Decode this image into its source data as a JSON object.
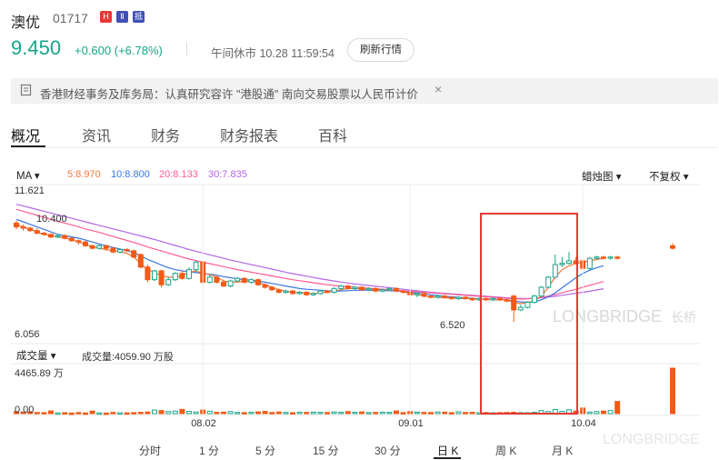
{
  "header": {
    "name": "澳优",
    "code": "01717",
    "badges": [
      {
        "text": "H",
        "color": "#e53935"
      },
      {
        "text": "Ⅱ",
        "color": "#3f51b5"
      },
      {
        "text": "抵",
        "color": "#3f51b5"
      }
    ],
    "price": "9.450",
    "change": "+0.600",
    "change_pct": "(+6.78%)",
    "status": "午间休市 10.28 11:59:54",
    "refresh_label": "刷新行情"
  },
  "notice": {
    "text": "香港财经事务及库务局：认真研究容许 \"港股通\" 南向交易股票以人民币计价",
    "close": "×"
  },
  "tabs": [
    "概况",
    "资讯",
    "财务",
    "财务报表",
    "百科"
  ],
  "indicators": {
    "ma_label": "MA",
    "ma5": "5:8.970",
    "ma10": "10:8.800",
    "ma20": "20:8.133",
    "ma30": "30:7.835",
    "chart_type": "蜡烛图",
    "adjust": "不复权",
    "vol_label": "成交量",
    "vol_value": "成交量:4059.90 万股"
  },
  "colors": {
    "up": "#17a589",
    "down": "#f25a16",
    "ma5": "#f07a3e",
    "ma10": "#3a78e0",
    "ma20": "#ff5c93",
    "ma30": "#b266e8",
    "highlight": "#e53935"
  },
  "watermark": {
    "main": "LONGBRIDGE",
    "cn": "长桥",
    "bottom": "LONGBRIDGE"
  },
  "periods": [
    "分时",
    "1 分",
    "5 分",
    "15 分",
    "30 分",
    "日 K",
    "周 K",
    "月 K"
  ],
  "active_period": "日 K",
  "chart_data": {
    "type": "candlestick",
    "price_axis": {
      "max_label": "11.621",
      "min_label": "6.056",
      "ylim": [
        6.056,
        11.621
      ]
    },
    "annotations": {
      "high": "10.400",
      "low": "6.520"
    },
    "volume_axis": {
      "max_label": "4465.89 万",
      "zero_label": "0.00",
      "ylim": [
        0,
        4465.89
      ]
    },
    "x_ticks": [
      {
        "label": "08.02",
        "index": 27
      },
      {
        "label": "09.01",
        "index": 57
      },
      {
        "label": "10.04",
        "index": 82
      }
    ],
    "candles": [
      {
        "o": 10.45,
        "c": 10.3,
        "h": 10.55,
        "l": 10.2
      },
      {
        "o": 10.3,
        "c": 10.25,
        "h": 10.4,
        "l": 10.15
      },
      {
        "o": 10.25,
        "c": 10.15,
        "h": 10.3,
        "l": 10.1
      },
      {
        "o": 10.15,
        "c": 10.05,
        "h": 10.25,
        "l": 10.0
      },
      {
        "o": 10.05,
        "c": 10.0,
        "h": 10.1,
        "l": 9.95
      },
      {
        "o": 10.0,
        "c": 9.9,
        "h": 10.05,
        "l": 9.85
      },
      {
        "o": 9.9,
        "c": 9.95,
        "h": 10.0,
        "l": 9.85
      },
      {
        "o": 9.95,
        "c": 9.85,
        "h": 10.0,
        "l": 9.8
      },
      {
        "o": 9.85,
        "c": 9.75,
        "h": 9.9,
        "l": 9.7
      },
      {
        "o": 9.75,
        "c": 9.7,
        "h": 9.8,
        "l": 9.6
      },
      {
        "o": 9.7,
        "c": 9.55,
        "h": 9.75,
        "l": 9.5
      },
      {
        "o": 9.55,
        "c": 9.45,
        "h": 9.6,
        "l": 9.4
      },
      {
        "o": 9.45,
        "c": 9.55,
        "h": 9.6,
        "l": 9.4
      },
      {
        "o": 9.55,
        "c": 9.45,
        "h": 9.6,
        "l": 9.35
      },
      {
        "o": 9.45,
        "c": 9.3,
        "h": 9.5,
        "l": 9.25
      },
      {
        "o": 9.3,
        "c": 9.4,
        "h": 9.45,
        "l": 9.25
      },
      {
        "o": 9.4,
        "c": 9.35,
        "h": 9.45,
        "l": 9.3
      },
      {
        "o": 9.35,
        "c": 9.1,
        "h": 9.4,
        "l": 9.05
      },
      {
        "o": 9.2,
        "c": 8.7,
        "h": 9.25,
        "l": 8.65
      },
      {
        "o": 8.7,
        "c": 8.2,
        "h": 8.8,
        "l": 8.1
      },
      {
        "o": 8.2,
        "c": 8.55,
        "h": 8.6,
        "l": 8.15
      },
      {
        "o": 8.55,
        "c": 8.0,
        "h": 8.6,
        "l": 7.9
      },
      {
        "o": 8.0,
        "c": 8.2,
        "h": 8.3,
        "l": 7.95
      },
      {
        "o": 8.2,
        "c": 8.45,
        "h": 8.5,
        "l": 8.15
      },
      {
        "o": 8.45,
        "c": 8.25,
        "h": 8.55,
        "l": 8.2
      },
      {
        "o": 8.25,
        "c": 8.6,
        "h": 8.7,
        "l": 8.2
      },
      {
        "o": 8.6,
        "c": 8.9,
        "h": 8.95,
        "l": 8.5
      },
      {
        "o": 8.9,
        "c": 8.1,
        "h": 8.95,
        "l": 8.0
      },
      {
        "o": 8.1,
        "c": 8.3,
        "h": 8.4,
        "l": 8.05
      },
      {
        "o": 8.3,
        "c": 8.1,
        "h": 8.35,
        "l": 8.05
      },
      {
        "o": 8.1,
        "c": 7.95,
        "h": 8.2,
        "l": 7.9
      },
      {
        "o": 7.95,
        "c": 8.15,
        "h": 8.2,
        "l": 7.9
      },
      {
        "o": 8.15,
        "c": 8.25,
        "h": 8.3,
        "l": 8.1
      },
      {
        "o": 8.25,
        "c": 8.1,
        "h": 8.3,
        "l": 8.05
      },
      {
        "o": 8.1,
        "c": 8.2,
        "h": 8.25,
        "l": 8.05
      },
      {
        "o": 8.2,
        "c": 8.0,
        "h": 8.25,
        "l": 7.95
      },
      {
        "o": 8.0,
        "c": 7.9,
        "h": 8.05,
        "l": 7.85
      },
      {
        "o": 7.9,
        "c": 7.8,
        "h": 7.95,
        "l": 7.75
      },
      {
        "o": 7.8,
        "c": 7.7,
        "h": 7.85,
        "l": 7.65
      },
      {
        "o": 7.7,
        "c": 7.75,
        "h": 7.8,
        "l": 7.65
      },
      {
        "o": 7.75,
        "c": 7.65,
        "h": 7.8,
        "l": 7.6
      },
      {
        "o": 7.65,
        "c": 7.7,
        "h": 7.75,
        "l": 7.6
      },
      {
        "o": 7.7,
        "c": 7.6,
        "h": 7.75,
        "l": 7.55
      },
      {
        "o": 7.6,
        "c": 7.65,
        "h": 7.7,
        "l": 7.55
      },
      {
        "o": 7.65,
        "c": 7.75,
        "h": 7.8,
        "l": 7.6
      },
      {
        "o": 7.75,
        "c": 7.7,
        "h": 7.8,
        "l": 7.65
      },
      {
        "o": 7.7,
        "c": 7.85,
        "h": 7.9,
        "l": 7.65
      },
      {
        "o": 7.85,
        "c": 7.95,
        "h": 8.0,
        "l": 7.8
      },
      {
        "o": 7.95,
        "c": 7.85,
        "h": 8.0,
        "l": 7.8
      },
      {
        "o": 7.85,
        "c": 7.9,
        "h": 7.95,
        "l": 7.8
      },
      {
        "o": 7.9,
        "c": 7.8,
        "h": 7.95,
        "l": 7.75
      },
      {
        "o": 7.8,
        "c": 7.85,
        "h": 7.9,
        "l": 7.75
      },
      {
        "o": 7.85,
        "c": 7.75,
        "h": 7.9,
        "l": 7.7
      },
      {
        "o": 7.75,
        "c": 7.8,
        "h": 7.85,
        "l": 7.7
      },
      {
        "o": 7.8,
        "c": 7.85,
        "h": 7.9,
        "l": 7.75
      },
      {
        "o": 7.85,
        "c": 7.75,
        "h": 7.9,
        "l": 7.7
      },
      {
        "o": 7.75,
        "c": 7.7,
        "h": 7.8,
        "l": 7.65
      },
      {
        "o": 7.7,
        "c": 7.6,
        "h": 7.75,
        "l": 7.55
      },
      {
        "o": 7.6,
        "c": 7.65,
        "h": 7.7,
        "l": 7.5
      },
      {
        "o": 7.65,
        "c": 7.55,
        "h": 7.7,
        "l": 7.5
      },
      {
        "o": 7.55,
        "c": 7.5,
        "h": 7.6,
        "l": 7.45
      },
      {
        "o": 7.5,
        "c": 7.55,
        "h": 7.6,
        "l": 7.45
      },
      {
        "o": 7.55,
        "c": 7.5,
        "h": 7.6,
        "l": 7.45
      },
      {
        "o": 7.5,
        "c": 7.45,
        "h": 7.55,
        "l": 7.4
      },
      {
        "o": 7.45,
        "c": 7.5,
        "h": 7.55,
        "l": 7.4
      },
      {
        "o": 7.5,
        "c": 7.45,
        "h": 7.55,
        "l": 7.4
      },
      {
        "o": 7.45,
        "c": 7.4,
        "h": 7.5,
        "l": 7.35
      },
      {
        "o": 7.4,
        "c": 7.45,
        "h": 7.5,
        "l": 7.35
      },
      {
        "o": 7.45,
        "c": 7.4,
        "h": 7.5,
        "l": 7.35
      },
      {
        "o": 7.4,
        "c": 7.45,
        "h": 7.5,
        "l": 7.35
      },
      {
        "o": 7.45,
        "c": 7.4,
        "h": 7.5,
        "l": 7.35
      },
      {
        "o": 7.4,
        "c": 7.35,
        "h": 7.45,
        "l": 7.3
      },
      {
        "o": 7.55,
        "c": 7.0,
        "h": 7.6,
        "l": 6.52
      },
      {
        "o": 7.0,
        "c": 7.1,
        "h": 7.2,
        "l": 6.95
      },
      {
        "o": 7.1,
        "c": 7.3,
        "h": 7.35,
        "l": 7.05
      },
      {
        "o": 7.3,
        "c": 7.55,
        "h": 7.6,
        "l": 7.25
      },
      {
        "o": 7.55,
        "c": 7.9,
        "h": 7.95,
        "l": 7.5
      },
      {
        "o": 7.9,
        "c": 8.3,
        "h": 8.35,
        "l": 7.85
      },
      {
        "o": 8.3,
        "c": 8.8,
        "h": 9.2,
        "l": 8.25
      },
      {
        "o": 8.8,
        "c": 8.85,
        "h": 9.1,
        "l": 8.7
      },
      {
        "o": 8.85,
        "c": 8.95,
        "h": 9.3,
        "l": 8.8
      },
      {
        "o": 8.95,
        "c": 8.85,
        "h": 9.1,
        "l": 8.8
      },
      {
        "o": 8.95,
        "c": 8.65,
        "h": 9.0,
        "l": 8.6
      },
      {
        "o": 8.65,
        "c": 9.05,
        "h": 9.1,
        "l": 8.6
      },
      {
        "o": 9.05,
        "c": 9.1,
        "h": 9.15,
        "l": 9.0
      },
      {
        "o": 9.1,
        "c": 9.05,
        "h": 9.15,
        "l": 9.0
      },
      {
        "o": 9.05,
        "c": 9.1,
        "h": 9.15,
        "l": 9.0
      },
      {
        "o": 9.1,
        "c": 9.05,
        "h": 9.15,
        "l": 9.0
      },
      null,
      null,
      null,
      null,
      null,
      null,
      null,
      {
        "o": 9.55,
        "c": 9.45,
        "h": 9.65,
        "l": 9.4
      }
    ],
    "volumes": [
      200,
      150,
      180,
      120,
      100,
      260,
      80,
      90,
      60,
      110,
      70,
      250,
      80,
      60,
      120,
      90,
      80,
      100,
      130,
      160,
      350,
      300,
      200,
      250,
      420,
      220,
      160,
      350,
      240,
      130,
      150,
      200,
      120,
      100,
      140,
      170,
      220,
      110,
      160,
      120,
      90,
      140,
      120,
      150,
      130,
      110,
      160,
      140,
      200,
      130,
      170,
      110,
      120,
      150,
      130,
      260,
      100,
      200,
      140,
      120,
      110,
      160,
      150,
      100,
      180,
      120,
      130,
      90,
      110,
      80,
      100,
      120,
      140,
      100,
      90,
      130,
      300,
      200,
      400,
      220,
      380,
      250,
      550,
      150,
      200,
      250,
      300,
      1200,
      0,
      0,
      0,
      0,
      0,
      0,
      0,
      4465.89
    ],
    "ma5": [
      10.4,
      10.3,
      10.2,
      10.1,
      10.0,
      9.95,
      9.9,
      9.85,
      9.8,
      9.7,
      9.6,
      9.5,
      9.45,
      9.4,
      9.35,
      9.3,
      9.25,
      9.1,
      8.85,
      8.6,
      8.5,
      8.35,
      8.3,
      8.3,
      8.35,
      8.5,
      8.55,
      8.45,
      8.4,
      8.3,
      8.15,
      8.1,
      8.1,
      8.15,
      8.12,
      8.1,
      8.0,
      7.9,
      7.8,
      7.75,
      7.7,
      7.68,
      7.65,
      7.65,
      7.68,
      7.7,
      7.75,
      7.8,
      7.85,
      7.85,
      7.85,
      7.82,
      7.8,
      7.78,
      7.8,
      7.78,
      7.72,
      7.65,
      7.6,
      7.55,
      7.52,
      7.5,
      7.48,
      7.47,
      7.46,
      7.45,
      7.44,
      7.43,
      7.42,
      7.4,
      7.4,
      7.4,
      7.3,
      7.25,
      7.3,
      7.35,
      7.55,
      7.9,
      8.3,
      8.6,
      8.75,
      8.85,
      8.9,
      8.95,
      9.0,
      9.05
    ],
    "ma10": [
      10.6,
      10.5,
      10.4,
      10.3,
      10.2,
      10.1,
      10.0,
      9.95,
      9.9,
      9.85,
      9.78,
      9.7,
      9.62,
      9.55,
      9.48,
      9.42,
      9.35,
      9.28,
      9.15,
      9.0,
      8.9,
      8.78,
      8.68,
      8.6,
      8.55,
      8.52,
      8.48,
      8.45,
      8.42,
      8.38,
      8.32,
      8.28,
      8.24,
      8.2,
      8.18,
      8.15,
      8.1,
      8.05,
      8.0,
      7.95,
      7.9,
      7.85,
      7.82,
      7.8,
      7.78,
      7.76,
      7.75,
      7.75,
      7.76,
      7.78,
      7.78,
      7.78,
      7.78,
      7.77,
      7.76,
      7.75,
      7.73,
      7.7,
      7.67,
      7.64,
      7.6,
      7.57,
      7.54,
      7.52,
      7.5,
      7.48,
      7.46,
      7.44,
      7.43,
      7.42,
      7.41,
      7.4,
      7.35,
      7.32,
      7.3,
      7.32,
      7.4,
      7.52,
      7.68,
      7.88,
      8.08,
      8.28,
      8.45,
      8.58,
      8.68,
      8.75
    ],
    "ma20": [
      11.0,
      10.92,
      10.84,
      10.76,
      10.68,
      10.6,
      10.52,
      10.45,
      10.38,
      10.3,
      10.22,
      10.15,
      10.08,
      10.0,
      9.92,
      9.84,
      9.76,
      9.68,
      9.6,
      9.5,
      9.42,
      9.34,
      9.26,
      9.18,
      9.1,
      9.02,
      8.96,
      8.9,
      8.84,
      8.78,
      8.72,
      8.66,
      8.6,
      8.55,
      8.5,
      8.45,
      8.4,
      8.35,
      8.3,
      8.25,
      8.2,
      8.16,
      8.12,
      8.08,
      8.04,
      8.0,
      7.97,
      7.94,
      7.92,
      7.9,
      7.88,
      7.86,
      7.84,
      7.82,
      7.8,
      7.78,
      7.76,
      7.74,
      7.72,
      7.7,
      7.68,
      7.66,
      7.64,
      7.62,
      7.6,
      7.58,
      7.56,
      7.54,
      7.52,
      7.5,
      7.48,
      7.46,
      7.44,
      7.43,
      7.44,
      7.46,
      7.5,
      7.55,
      7.61,
      7.68,
      7.75,
      7.82,
      7.9,
      7.98,
      8.05,
      8.13
    ],
    "ma30": [
      11.2,
      11.13,
      11.06,
      10.99,
      10.92,
      10.85,
      10.78,
      10.71,
      10.64,
      10.57,
      10.5,
      10.43,
      10.36,
      10.29,
      10.22,
      10.15,
      10.08,
      10.01,
      9.94,
      9.87,
      9.8,
      9.72,
      9.64,
      9.56,
      9.48,
      9.4,
      9.33,
      9.26,
      9.19,
      9.12,
      9.05,
      8.98,
      8.92,
      8.86,
      8.8,
      8.74,
      8.68,
      8.62,
      8.56,
      8.5,
      8.44,
      8.39,
      8.34,
      8.29,
      8.24,
      8.19,
      8.15,
      8.11,
      8.07,
      8.03,
      8.0,
      7.97,
      7.94,
      7.91,
      7.88,
      7.85,
      7.82,
      7.79,
      7.76,
      7.73,
      7.7,
      7.68,
      7.66,
      7.64,
      7.62,
      7.6,
      7.58,
      7.56,
      7.54,
      7.52,
      7.5,
      7.48,
      7.46,
      7.45,
      7.45,
      7.46,
      7.48,
      7.51,
      7.54,
      7.58,
      7.62,
      7.66,
      7.7,
      7.74,
      7.79,
      7.84
    ]
  }
}
